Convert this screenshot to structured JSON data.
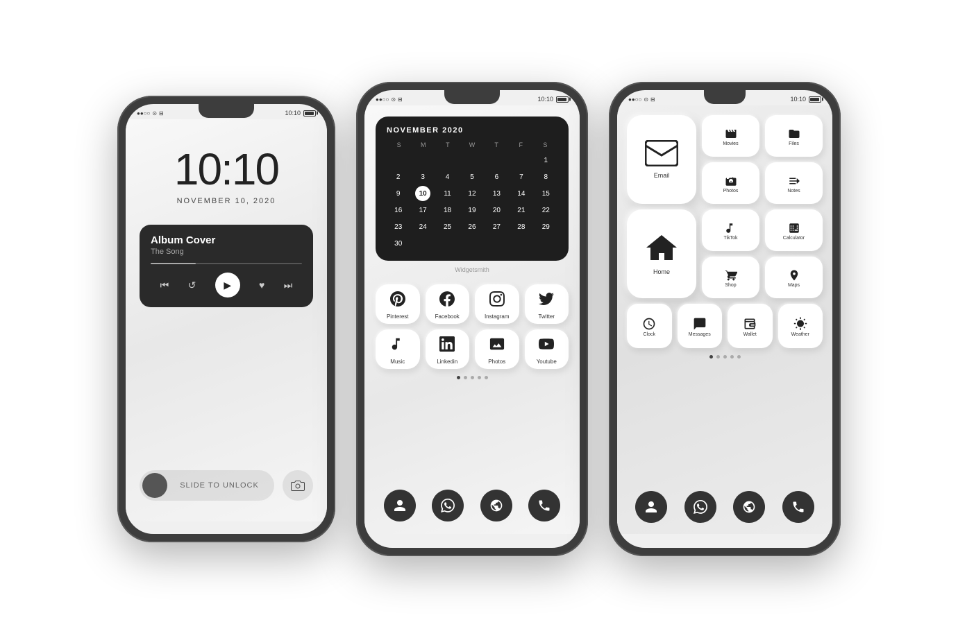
{
  "page": {
    "background": "#ffffff"
  },
  "phone1": {
    "status_left": "●●○○ ⊙ ⊟",
    "time_display": "10:10",
    "status_time": "10:10",
    "date_display": "NOVEMBER 10, 2020",
    "music": {
      "album": "Album Cover",
      "song": "The Song",
      "controls": {
        "prev": "⏮",
        "replay": "↺",
        "play": "▶",
        "heart": "♥",
        "next": "⏭"
      }
    },
    "slide_text": "SLIDE TO UNLOCK"
  },
  "phone2": {
    "status_time": "10:10",
    "calendar": {
      "title": "NOVEMBER 2020",
      "weekdays": [
        "S",
        "M",
        "T",
        "W",
        "T",
        "F",
        "S"
      ],
      "weeks": [
        [
          "",
          "",
          "",
          "",
          "",
          "",
          "1"
        ],
        [
          "2",
          "3",
          "4",
          "5",
          "6",
          "7",
          "8"
        ],
        [
          "9",
          "10",
          "11",
          "12",
          "13",
          "14",
          "15"
        ],
        [
          "16",
          "17",
          "18",
          "19",
          "20",
          "21",
          "22"
        ],
        [
          "23",
          "24",
          "25",
          "26",
          "27",
          "28",
          "29"
        ],
        [
          "30",
          "",
          "",
          "",
          "",
          "",
          ""
        ]
      ],
      "today": "10",
      "widget_label": "Widgetsmith"
    },
    "social_apps": [
      {
        "icon": "𝗣",
        "label": "Pinterest"
      },
      {
        "icon": "f",
        "label": "Facebook"
      },
      {
        "icon": "◎",
        "label": "Instagram"
      },
      {
        "icon": "🐦",
        "label": "Twitter"
      }
    ],
    "media_apps": [
      {
        "icon": "♫",
        "label": "Music"
      },
      {
        "icon": "in",
        "label": "Linkedin"
      },
      {
        "icon": "⊞",
        "label": "Photos"
      },
      {
        "icon": "▶",
        "label": "Youtube"
      }
    ],
    "dock_icons": [
      "person",
      "whatsapp",
      "globe",
      "phone"
    ]
  },
  "phone3": {
    "status_time": "10:10",
    "apps_row1": [
      {
        "icon": "✉",
        "label": "Email",
        "big": true
      },
      {
        "icon": "🎬",
        "label": "Movies"
      },
      {
        "icon": "📁",
        "label": "Files"
      }
    ],
    "apps_row2": [
      {
        "icon": "📷",
        "label": "Photos"
      },
      {
        "icon": "📋",
        "label": "Notes"
      }
    ],
    "apps_row3": [
      {
        "icon": "⌂",
        "label": "Home",
        "big": true
      },
      {
        "icon": "♪",
        "label": "TikTok"
      },
      {
        "icon": "≡",
        "label": "Calculator"
      }
    ],
    "apps_row4": [
      {
        "icon": "🛒",
        "label": "Shop"
      },
      {
        "icon": "📍",
        "label": "Maps"
      }
    ],
    "apps_bottom": [
      {
        "icon": "🕐",
        "label": "Clock"
      },
      {
        "icon": "💬",
        "label": "Messages"
      },
      {
        "icon": "👛",
        "label": "Wallet"
      },
      {
        "icon": "⛅",
        "label": "Weather"
      }
    ],
    "dock_icons": [
      "person",
      "whatsapp",
      "globe",
      "phone"
    ]
  }
}
